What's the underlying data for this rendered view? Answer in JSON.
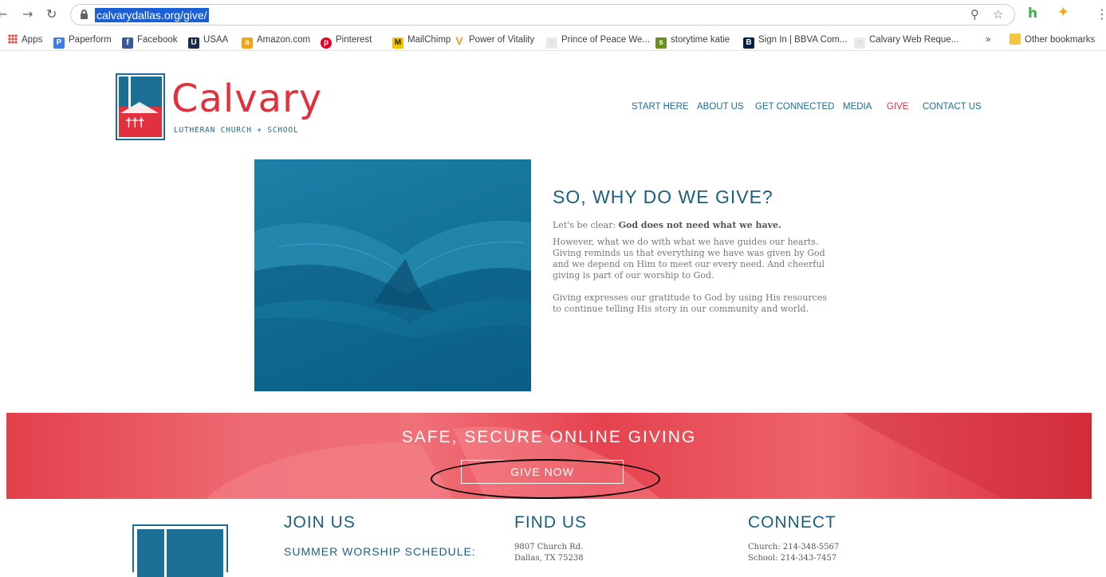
{
  "browser": {
    "url": "calvarydallas.org/give/",
    "bookmarks": [
      {
        "label": "Apps",
        "icon": "apps-grid-icon",
        "color": "#ea4335"
      },
      {
        "label": "Paperform",
        "icon": "paperform-icon",
        "color": "#3b7de9"
      },
      {
        "label": "Facebook",
        "icon": "facebook-icon",
        "color": "#3b5998"
      },
      {
        "label": "USAA",
        "icon": "usaa-icon",
        "color": "#1c2d4a"
      },
      {
        "label": "Amazon.com",
        "icon": "amazon-icon",
        "color": "#f4a41c"
      },
      {
        "label": "Pinterest",
        "icon": "pinterest-icon",
        "color": "#e60023"
      },
      {
        "label": "MailChimp",
        "icon": "mailchimp-icon",
        "color": "#f2c500"
      },
      {
        "label": "Power of Vitality",
        "icon": "vitality-icon",
        "color": "#e8a030"
      },
      {
        "label": "Prince of Peace We...",
        "icon": "web-icon",
        "color": "#9aa0a6"
      },
      {
        "label": "storytime katie",
        "icon": "storytime-icon",
        "color": "#6b8e23"
      },
      {
        "label": "Sign In | BBVA Com...",
        "icon": "bbva-icon",
        "color": "#072146"
      },
      {
        "label": "Calvary Web Reque...",
        "icon": "web-icon",
        "color": "#9aa0a6"
      }
    ],
    "overflow": "»",
    "other_bookmarks": "Other bookmarks"
  },
  "site": {
    "brand": "Calvary",
    "brand_sub": "LUTHERAN CHURCH + SCHOOL",
    "nav": [
      "START HERE",
      "ABOUT US",
      "GET CONNECTED",
      "MEDIA",
      "GIVE",
      "CONTACT US"
    ],
    "active_nav": "GIVE"
  },
  "content": {
    "title": "SO, WHY DO WE GIVE?",
    "p1_lead": "Let's be clear: ",
    "p1_bold": "God does not need what we have.",
    "p2": "However, what we do with what we have guides our hearts. Giving reminds us that everything we have was given by God and we depend on Him to meet our every need. And cheerful giving is part of our worship to God.",
    "p3": "Giving expresses our gratitude to God by using His resources to continue telling His story in our community and world."
  },
  "banner": {
    "title": "SAFE, SECURE ONLINE GIVING",
    "button": "GIVE NOW"
  },
  "footer": {
    "join_title": "JOIN US",
    "join_sub": "SUMMER WORSHIP SCHEDULE:",
    "find_title": "FIND US",
    "address_1": "9807 Church Rd.",
    "address_2": "Dallas, TX 75238",
    "connect_title": "CONNECT",
    "church_phone": "Church: 214-348-5567",
    "school_phone": "School: 214-343-7457"
  },
  "colors": {
    "brand_blue": "#1b6f95",
    "brand_red": "#e2313e"
  }
}
